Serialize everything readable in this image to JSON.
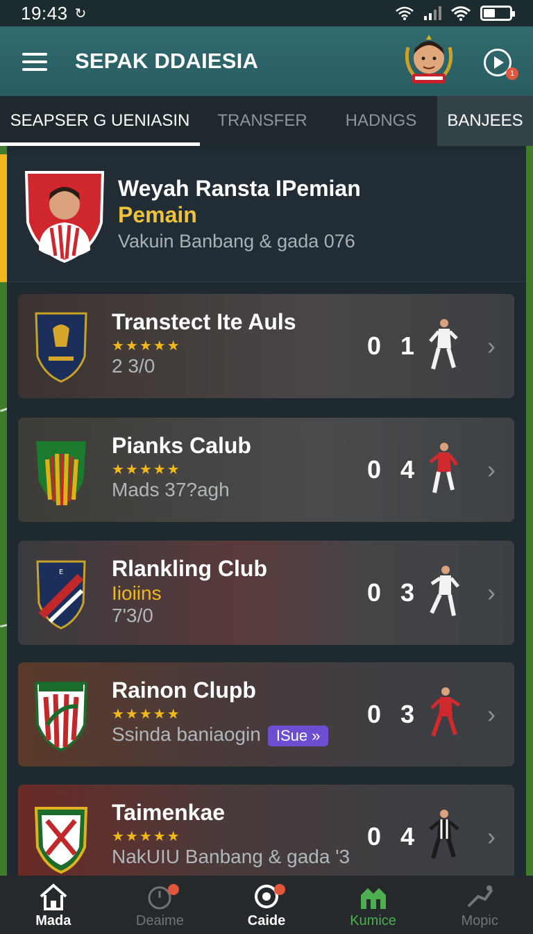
{
  "status_bar": {
    "time": "19:43",
    "sync_glyph": "↻"
  },
  "header": {
    "title": "SEPAK DDAIESIA",
    "notification_count": "1",
    "icons": [
      "menu-icon",
      "team-mascot-logo",
      "play-icon"
    ]
  },
  "tabs": [
    {
      "label": "SEAPSER G UENIASIN",
      "active": true
    },
    {
      "label": "TRANSFER",
      "active": false
    },
    {
      "label": "HADNGS",
      "active": false
    },
    {
      "label": "BANJEES",
      "active": false
    }
  ],
  "profile": {
    "name": "Weyah Ransta IPemian",
    "role": "Pemain",
    "subtitle": "Vakuin Banbang & gada 076"
  },
  "clubs": [
    {
      "name": "Transtect Ite Auls",
      "stars": "★★★★★",
      "subtitle": "2 3/0",
      "score_left": "0",
      "score_right": "1",
      "kit": "white"
    },
    {
      "name": "Pianks Calub",
      "stars": "★★★★★",
      "subtitle": "Mads 37?agh",
      "score_left": "0",
      "score_right": "4",
      "kit": "red"
    },
    {
      "name": "Rlankling Club",
      "stars": "",
      "subtitle": "Iioiins",
      "subtitle2": "7'3/0",
      "score_left": "0",
      "score_right": "3",
      "kit": "white"
    },
    {
      "name": "Rainon Clupb",
      "stars": "★★★★★",
      "subtitle": "Ssinda baniaogin",
      "badge": "ISue »",
      "score_left": "0",
      "score_right": "3",
      "kit": "red"
    },
    {
      "name": "Taimenkae",
      "stars": "★★★★★",
      "subtitle": "NakUIU Banbang & gada '3",
      "score_left": "0",
      "score_right": "4",
      "kit": "black"
    }
  ],
  "bottom_nav": [
    {
      "label": "Mada",
      "icon": "home-icon",
      "color": "#ffffff",
      "badge": false
    },
    {
      "label": "Deaime",
      "icon": "stopwatch-icon",
      "color": "#6f7579",
      "badge": true
    },
    {
      "label": "Caide",
      "icon": "ball-icon",
      "color": "#ffffff",
      "badge": true
    },
    {
      "label": "Kumice",
      "icon": "stadium-icon",
      "color": "#4caf50",
      "badge": false
    },
    {
      "label": "Mopic",
      "icon": "kick-icon",
      "color": "#6f7579",
      "badge": false
    }
  ],
  "colors": {
    "accent_gold": "#f0b81c",
    "header_teal": "#2f6b6f",
    "badge_purple": "#6c4fd1",
    "notification_red": "#e2573c"
  }
}
